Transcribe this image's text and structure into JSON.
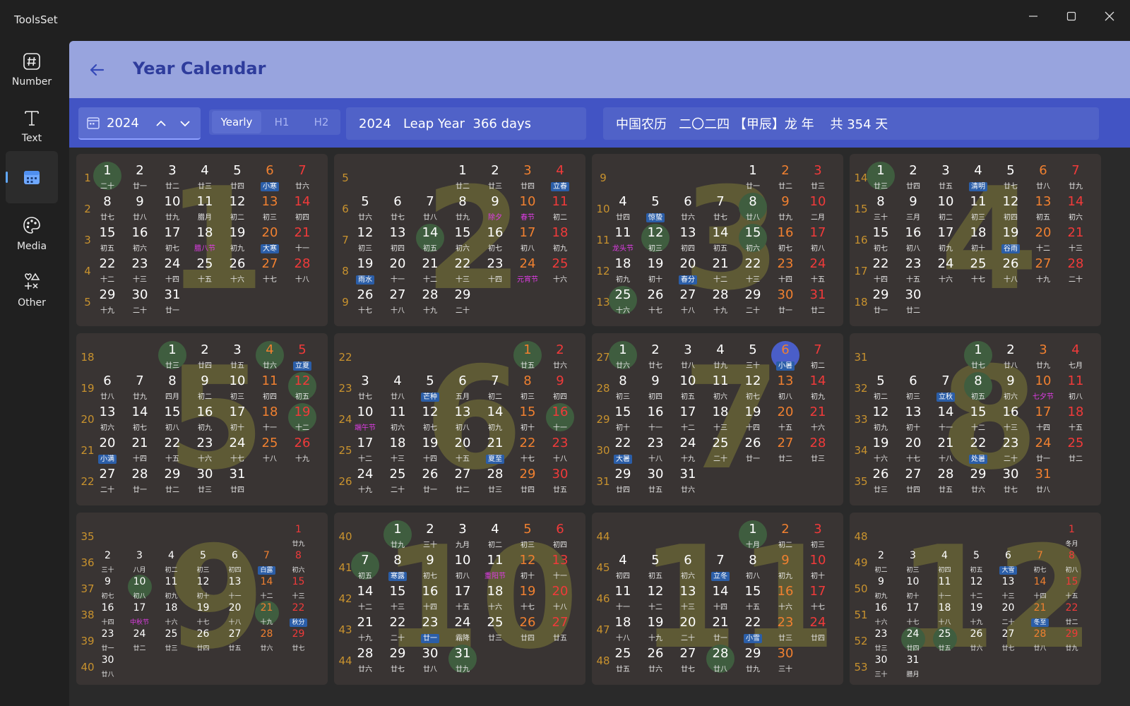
{
  "app": {
    "title": "ToolsSet"
  },
  "sidebar": {
    "items": [
      {
        "label": "Number",
        "icon": "number-icon"
      },
      {
        "label": "Text",
        "icon": "text-icon"
      },
      {
        "label": "",
        "icon": "calendar-icon"
      },
      {
        "label": "Media",
        "icon": "palette-icon"
      },
      {
        "label": "Other",
        "icon": "shapes-icon"
      }
    ]
  },
  "header": {
    "title": "Year Calendar"
  },
  "toolbar": {
    "year": "2024",
    "segments": [
      "Yearly",
      "H1",
      "H2"
    ],
    "selected_segment": "Yearly",
    "year_info": "2024   Leap Year  366 days",
    "lunar_info": "中国农历   二〇二四 【甲辰】龙 年    共 354 天"
  },
  "colors": {
    "accent": "#4254c4",
    "header": "#98a4de",
    "saturday": "#f08030",
    "sunday": "#f03a3a",
    "term_badge": "#2b5ea8",
    "festival": "#e03ce6"
  },
  "months": [
    {
      "month": "1",
      "startDow": 0,
      "days": 31,
      "firstWeek": 1,
      "lunar": [
        "二十",
        "廿一",
        "廿二",
        "廿三",
        "廿四",
        "小寒",
        "廿六",
        "廿七",
        "廿八",
        "廿九",
        "腊月",
        "初二",
        "初三",
        "初四",
        "初五",
        "初六",
        "初七",
        "腊八节",
        "初九",
        "大寒",
        "十一",
        "十二",
        "十三",
        "十四",
        "十五",
        "十六",
        "十七",
        "十八",
        "十九",
        "二十",
        "廿一"
      ],
      "terms": [
        6,
        20
      ],
      "fests": [
        18
      ],
      "circles": [
        1
      ]
    },
    {
      "month": "2",
      "startDow": 3,
      "days": 29,
      "firstWeek": 5,
      "lunar": [
        "廿二",
        "廿三",
        "廿四",
        "立春",
        "廿六",
        "廿七",
        "廿八",
        "廿九",
        "除夕",
        "春节",
        "初二",
        "初三",
        "初四",
        "初五",
        "初六",
        "初七",
        "初八",
        "初九",
        "雨水",
        "十一",
        "十二",
        "十三",
        "十四",
        "元宵节",
        "十六",
        "十七",
        "十八",
        "十九",
        "二十"
      ],
      "terms": [
        4,
        19
      ],
      "fests": [
        9,
        10,
        24
      ],
      "circles": [
        14
      ]
    },
    {
      "month": "3",
      "startDow": 4,
      "days": 31,
      "firstWeek": 9,
      "lunar": [
        "廿一",
        "廿二",
        "廿三",
        "廿四",
        "惊蛰",
        "廿六",
        "廿七",
        "廿八",
        "廿九",
        "二月",
        "龙头节",
        "初三",
        "初四",
        "初五",
        "初六",
        "初七",
        "初八",
        "初九",
        "初十",
        "春分",
        "十二",
        "十三",
        "十四",
        "十五",
        "十六",
        "十七",
        "十八",
        "十九",
        "二十",
        "廿一",
        "廿二"
      ],
      "terms": [
        5,
        20
      ],
      "fests": [
        11
      ],
      "circles": [
        8,
        12,
        15,
        25
      ]
    },
    {
      "month": "4",
      "startDow": 0,
      "days": 30,
      "firstWeek": 14,
      "lunar": [
        "廿三",
        "廿四",
        "廿五",
        "清明",
        "廿七",
        "廿八",
        "廿九",
        "三十",
        "三月",
        "初二",
        "初三",
        "初四",
        "初五",
        "初六",
        "初七",
        "初八",
        "初九",
        "初十",
        "谷雨",
        "十二",
        "十三",
        "十四",
        "十五",
        "十六",
        "十七",
        "十八",
        "十九",
        "二十",
        "廿一",
        "廿二"
      ],
      "terms": [
        4,
        19
      ],
      "fests": [],
      "circles": [
        1
      ]
    },
    {
      "month": "5",
      "startDow": 2,
      "days": 31,
      "firstWeek": 18,
      "lunar": [
        "廿三",
        "廿四",
        "廿五",
        "廿六",
        "立夏",
        "廿八",
        "廿九",
        "四月",
        "初二",
        "初三",
        "初四",
        "初五",
        "初六",
        "初七",
        "初八",
        "初九",
        "初十",
        "十一",
        "十二",
        "小满",
        "十四",
        "十五",
        "十六",
        "十七",
        "十八",
        "十九",
        "二十",
        "廿一",
        "廿二",
        "廿三",
        "廿四"
      ],
      "terms": [
        5,
        20
      ],
      "fests": [],
      "circles": [
        1,
        4,
        12,
        19
      ]
    },
    {
      "month": "6",
      "startDow": 5,
      "days": 30,
      "firstWeek": 22,
      "lunar": [
        "廿五",
        "廿六",
        "廿七",
        "廿八",
        "芒种",
        "五月",
        "初二",
        "初三",
        "初四",
        "端午节",
        "初六",
        "初七",
        "初八",
        "初九",
        "初十",
        "十一",
        "十二",
        "十三",
        "十四",
        "十五",
        "夏至",
        "十七",
        "十八",
        "十九",
        "二十",
        "廿一",
        "廿二",
        "廿三",
        "廿四",
        "廿五"
      ],
      "terms": [
        5,
        21
      ],
      "fests": [
        10
      ],
      "circles": [
        1,
        16
      ]
    },
    {
      "month": "7",
      "startDow": 0,
      "days": 31,
      "firstWeek": 27,
      "lunar": [
        "廿六",
        "廿七",
        "廿八",
        "廿九",
        "三十",
        "小暑",
        "初二",
        "初三",
        "初四",
        "初五",
        "初六",
        "初七",
        "初八",
        "初九",
        "初十",
        "十一",
        "十二",
        "十三",
        "十四",
        "十五",
        "十六",
        "大暑",
        "十八",
        "十九",
        "二十",
        "廿一",
        "廿二",
        "廿三",
        "廿四",
        "廿五",
        "廿六"
      ],
      "terms": [
        6,
        22
      ],
      "fests": [],
      "circles": [
        1,
        6
      ],
      "today": 6
    },
    {
      "month": "8",
      "startDow": 3,
      "days": 31,
      "firstWeek": 31,
      "lunar": [
        "廿七",
        "廿八",
        "廿九",
        "七月",
        "初二",
        "初三",
        "立秋",
        "初五",
        "初六",
        "七夕节",
        "初八",
        "初九",
        "初十",
        "十一",
        "十二",
        "十三",
        "十四",
        "十五",
        "十六",
        "十七",
        "十八",
        "处暑",
        "二十",
        "廿一",
        "廿二",
        "廿三",
        "廿四",
        "廿五",
        "廿六",
        "廿七",
        "廿八"
      ],
      "terms": [
        7,
        22
      ],
      "fests": [
        10
      ],
      "circles": [
        1,
        8
      ]
    },
    {
      "month": "9",
      "startDow": 6,
      "days": 30,
      "firstWeek": 35,
      "lunar": [
        "廿九",
        "三十",
        "八月",
        "初二",
        "初三",
        "初四",
        "白露",
        "初六",
        "初七",
        "初八",
        "初九",
        "初十",
        "十一",
        "十二",
        "十三",
        "十四",
        "中秋节",
        "十六",
        "十七",
        "十八",
        "十九",
        "秋分",
        "廿一",
        "廿二",
        "廿三",
        "廿四",
        "廿五",
        "廿六",
        "廿七",
        "廿八"
      ],
      "terms": [
        7,
        22
      ],
      "fests": [
        17
      ],
      "circles": [
        10,
        21
      ]
    },
    {
      "month": "10",
      "startDow": 1,
      "days": 31,
      "firstWeek": 40,
      "lunar": [
        "廿九",
        "三十",
        "九月",
        "初二",
        "初三",
        "初四",
        "初五",
        "寒露",
        "初七",
        "初八",
        "重阳节",
        "初十",
        "十一",
        "十二",
        "十三",
        "十四",
        "十五",
        "十六",
        "十七",
        "十八",
        "十九",
        "二十",
        "廿一",
        "霜降",
        "廿三",
        "廿四",
        "廿五",
        "廿六",
        "廿七",
        "廿八",
        "廿九"
      ],
      "terms": [
        8,
        23
      ],
      "fests": [
        11
      ],
      "circles": [
        1,
        7,
        31
      ]
    },
    {
      "month": "11",
      "startDow": 4,
      "days": 30,
      "firstWeek": 44,
      "lunar": [
        "十月",
        "初二",
        "初三",
        "初四",
        "初五",
        "初六",
        "立冬",
        "初八",
        "初九",
        "初十",
        "十一",
        "十二",
        "十三",
        "十四",
        "十五",
        "十六",
        "十七",
        "十八",
        "十九",
        "二十",
        "廿一",
        "小雪",
        "廿三",
        "廿四",
        "廿五",
        "廿六",
        "廿七",
        "廿八",
        "廿九",
        "三十"
      ],
      "terms": [
        7,
        22
      ],
      "fests": [],
      "circles": [
        1,
        28
      ]
    },
    {
      "month": "12",
      "startDow": 6,
      "days": 31,
      "firstWeek": 48,
      "lunar": [
        "冬月",
        "初二",
        "初三",
        "初四",
        "初五",
        "大雪",
        "初七",
        "初八",
        "初九",
        "初十",
        "十一",
        "十二",
        "十三",
        "十四",
        "十五",
        "十六",
        "十七",
        "十八",
        "十九",
        "二十",
        "冬至",
        "廿二",
        "廿三",
        "廿四",
        "廿五",
        "廿六",
        "廿七",
        "廿八",
        "廿九",
        "三十",
        "腊月"
      ],
      "terms": [
        6,
        21
      ],
      "fests": [],
      "circles": [
        24,
        25
      ]
    }
  ]
}
